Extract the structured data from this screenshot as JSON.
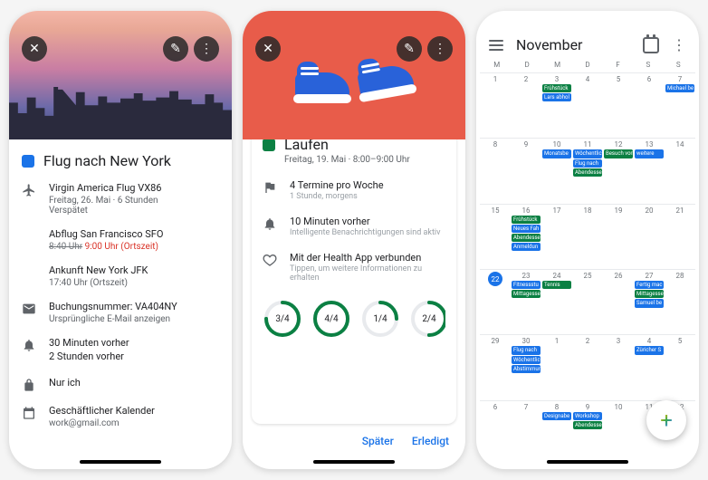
{
  "flight": {
    "chip_color": "#1a73e8",
    "title": "Flug nach New York",
    "airline_line": "Virgin America Flug VX86",
    "date_dur": "Freitag, 26. Mai · 6 Stunden",
    "status": "Verspätet",
    "dep_title": "Abflug San Francisco SFO",
    "dep_old": "8:40 Uhr",
    "dep_new": "9:00 Uhr (Ortszeit)",
    "arr_title": "Ankunft New York JFK",
    "arr_time": "17:40 Uhr (Ortszeit)",
    "booking_label": "Buchungsnummer: VA404NY",
    "booking_sub": "Ursprüngliche E-Mail anzeigen",
    "reminder1": "30 Minuten vorher",
    "reminder2": "2 Stunden vorher",
    "visibility": "Nur ich",
    "calendar_name": "Geschäftlicher Kalender",
    "calendar_email": "work@gmail.com"
  },
  "run": {
    "chip_color": "#0b8043",
    "title": "Laufen",
    "subtitle": "Freitag, 19. Mai · 8:00–9:00 Uhr",
    "freq_main": "4 Termine pro Woche",
    "freq_sub": "1 Stunde, morgens",
    "notif_main": "10 Minuten vorher",
    "notif_sub": "Intelligente Benachrichtigungen sind aktiv",
    "health_main": "Mit der Health App verbunden",
    "health_sub": "Tippen, um weitere Informationen zu erhalten",
    "rings": [
      {
        "done": 3,
        "total": 4,
        "label": "3/4"
      },
      {
        "done": 4,
        "total": 4,
        "label": "4/4"
      },
      {
        "done": 1,
        "total": 4,
        "label": "1/4"
      },
      {
        "done": 2,
        "total": 4,
        "label": "2/4"
      }
    ],
    "later": "Später",
    "done": "Erledigt"
  },
  "month": {
    "title": "November",
    "dow": [
      "M",
      "D",
      "M",
      "D",
      "F",
      "S",
      "S"
    ],
    "weeks": [
      [
        {
          "n": 1,
          "e": []
        },
        {
          "n": 2,
          "e": []
        },
        {
          "n": 3,
          "e": [
            {
              "t": "Frühstück",
              "c": "g"
            },
            {
              "t": "Lars abhol",
              "c": "b"
            }
          ]
        },
        {
          "n": 4,
          "e": []
        },
        {
          "n": 5,
          "e": []
        },
        {
          "n": 6,
          "e": []
        },
        {
          "n": 7,
          "e": [
            {
              "t": "Michael be",
              "c": "b"
            }
          ]
        }
      ],
      [
        {
          "n": 8,
          "e": []
        },
        {
          "n": 9,
          "e": []
        },
        {
          "n": 10,
          "e": [
            {
              "t": "Monatsbe",
              "c": "b"
            }
          ]
        },
        {
          "n": 11,
          "e": [
            {
              "t": "Wöchentlic",
              "c": "b"
            },
            {
              "t": "Flug nach",
              "c": "b"
            },
            {
              "t": "Abendesse",
              "c": "g"
            }
          ]
        },
        {
          "n": 12,
          "e": [
            {
              "t": "Besuch von",
              "c": "g"
            }
          ]
        },
        {
          "n": 13,
          "e": [
            {
              "t": "weitere",
              "c": "b"
            }
          ]
        },
        {
          "n": 14,
          "e": []
        }
      ],
      [
        {
          "n": 15,
          "e": []
        },
        {
          "n": 16,
          "e": [
            {
              "t": "Frühstück",
              "c": "g"
            },
            {
              "t": "Neues Fah",
              "c": "b"
            },
            {
              "t": "Abendesse",
              "c": "g"
            },
            {
              "t": "Anmeldun",
              "c": "b"
            }
          ]
        },
        {
          "n": 17,
          "e": []
        },
        {
          "n": 18,
          "e": []
        },
        {
          "n": 19,
          "e": []
        },
        {
          "n": 20,
          "e": []
        },
        {
          "n": 21,
          "e": []
        }
      ],
      [
        {
          "n": 22,
          "today": true,
          "e": []
        },
        {
          "n": 23,
          "e": [
            {
              "t": "Fitnessstu",
              "c": "b"
            },
            {
              "t": "Mittagesse",
              "c": "g"
            }
          ]
        },
        {
          "n": 24,
          "e": [
            {
              "t": "Tennis",
              "c": "g"
            }
          ]
        },
        {
          "n": 25,
          "e": []
        },
        {
          "n": 26,
          "e": []
        },
        {
          "n": 27,
          "e": [
            {
              "t": "Fertig mac",
              "c": "b"
            },
            {
              "t": "Mittagesse",
              "c": "g"
            },
            {
              "t": "Samuel be",
              "c": "b"
            }
          ]
        },
        {
          "n": 28,
          "e": []
        }
      ],
      [
        {
          "n": 29,
          "e": []
        },
        {
          "n": 30,
          "e": [
            {
              "t": "Flug nach",
              "c": "b"
            },
            {
              "t": "Wöchentlic",
              "c": "b"
            },
            {
              "t": "Abstimmur",
              "c": "b"
            }
          ]
        },
        {
          "n": 1,
          "e": []
        },
        {
          "n": 2,
          "e": []
        },
        {
          "n": 3,
          "e": []
        },
        {
          "n": 4,
          "e": [
            {
              "t": "Züricher S",
              "c": "b"
            }
          ]
        },
        {
          "n": 5,
          "e": []
        }
      ],
      [
        {
          "n": 6,
          "e": []
        },
        {
          "n": 7,
          "e": []
        },
        {
          "n": 8,
          "e": [
            {
              "t": "Designabe",
              "c": "b"
            }
          ]
        },
        {
          "n": 9,
          "e": [
            {
              "t": "Workshop",
              "c": "b"
            },
            {
              "t": "Abendesse",
              "c": "g"
            }
          ]
        },
        {
          "n": 10,
          "e": []
        },
        {
          "n": 11,
          "e": []
        },
        {
          "n": 12,
          "e": []
        }
      ]
    ]
  }
}
